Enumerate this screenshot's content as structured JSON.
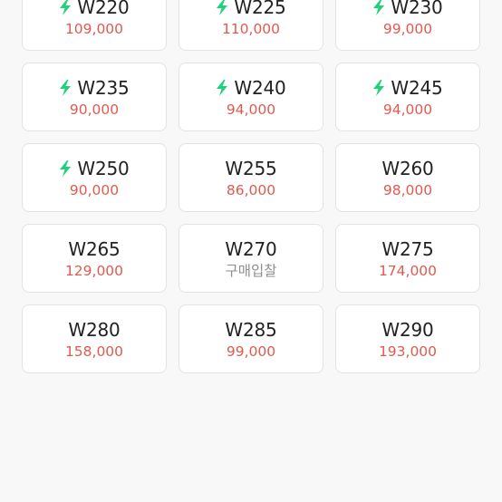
{
  "colors": {
    "price": "#e05a4f",
    "bid": "#8e8e8e",
    "bolt": "#1fd17a",
    "text": "#222222"
  },
  "cards": [
    {
      "size": "W220",
      "price": "109,000",
      "fast": true
    },
    {
      "size": "W225",
      "price": "110,000",
      "fast": true
    },
    {
      "size": "W230",
      "price": "99,000",
      "fast": true
    },
    {
      "size": "W235",
      "price": "90,000",
      "fast": true
    },
    {
      "size": "W240",
      "price": "94,000",
      "fast": true
    },
    {
      "size": "W245",
      "price": "94,000",
      "fast": true
    },
    {
      "size": "W250",
      "price": "90,000",
      "fast": true
    },
    {
      "size": "W255",
      "price": "86,000",
      "fast": false
    },
    {
      "size": "W260",
      "price": "98,000",
      "fast": false
    },
    {
      "size": "W265",
      "price": "129,000",
      "fast": false
    },
    {
      "size": "W270",
      "price": "구매입찰",
      "fast": false,
      "bid": true
    },
    {
      "size": "W275",
      "price": "174,000",
      "fast": false
    },
    {
      "size": "W280",
      "price": "158,000",
      "fast": false
    },
    {
      "size": "W285",
      "price": "99,000",
      "fast": false
    },
    {
      "size": "W290",
      "price": "193,000",
      "fast": false
    }
  ]
}
